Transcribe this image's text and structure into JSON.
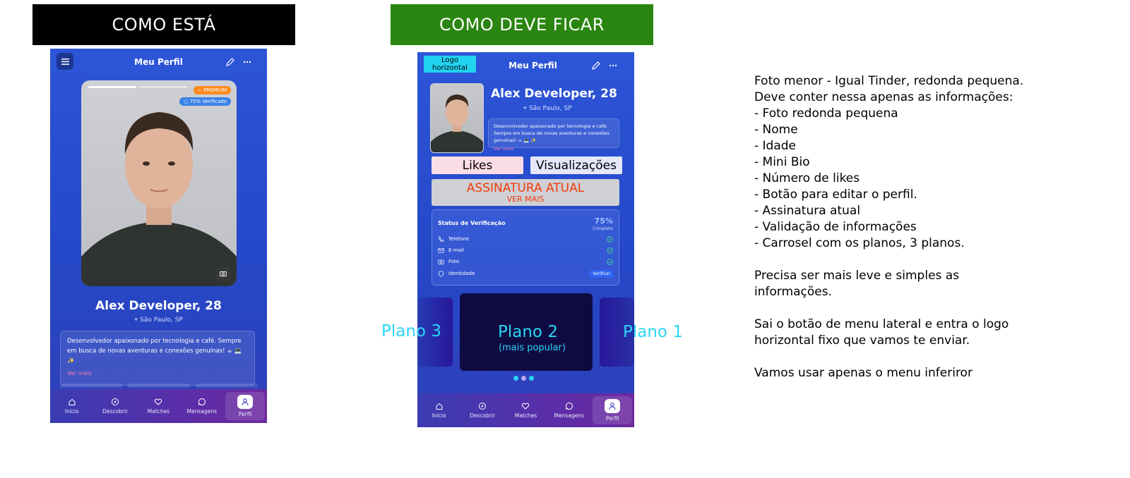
{
  "banners": {
    "current": "COMO ESTÁ",
    "target": "COMO DEVE FICAR"
  },
  "profile": {
    "header_title": "Meu Perfil",
    "name_age": "Alex Developer, 28",
    "location": "São Paulo, SP",
    "bio": "Desenvolvedor apaixonado por tecnologia e café. Sempre em busca de novas aventuras e conexões genuínas! ☕ 💻 ✨",
    "see_more": "Ver mais",
    "badge_premium": "☆ PREMIUM",
    "badge_verified": "○ 75% Verificado"
  },
  "target_mockup": {
    "logo_placeholder": "Logo horizontal",
    "likes_label": "Likes",
    "views_label": "Visualizações",
    "subscription_title": "ASSINATURA ATUAL",
    "subscription_more": "VER MAIS",
    "verification": {
      "title": "Status de Verificação",
      "percent": "75%",
      "percent_caption": "Completo",
      "items": [
        {
          "label": "Telefone",
          "status": "verified",
          "icon": "phone-icon"
        },
        {
          "label": "E-mail",
          "status": "verified",
          "icon": "mail-icon"
        },
        {
          "label": "Foto",
          "status": "verified",
          "icon": "camera-icon"
        },
        {
          "label": "Identidade",
          "status": "pending",
          "icon": "shield-icon",
          "action": "Verificar"
        }
      ]
    },
    "plans": {
      "left": "Plano 3",
      "center": "Plano 2",
      "center_sub": "(mais popular)",
      "right": "Plano 1",
      "dot_count": 3
    }
  },
  "nav": [
    {
      "label": "Início",
      "icon": "home-icon",
      "active": false
    },
    {
      "label": "Descobrir",
      "icon": "compass-icon",
      "active": false
    },
    {
      "label": "Matches",
      "icon": "heart-icon",
      "active": false
    },
    {
      "label": "Mensagens",
      "icon": "chat-icon",
      "active": false
    },
    {
      "label": "Perfil",
      "icon": "user-icon",
      "active": true
    }
  ],
  "notes": [
    "Foto menor - Igual Tinder, redonda pequena.",
    "Deve conter nessa apenas as informações:",
    "- Foto redonda pequena",
    "- Nome",
    "- Idade",
    "- Mini Bio",
    "- Número de likes",
    "- Botão para editar o perfil.",
    "- Assinatura atual",
    "- Validação de informações",
    "- Carrosel com os planos, 3 planos.",
    "",
    "Precisa ser mais leve e simples as",
    "informações.",
    "",
    "Sai o botão de menu lateral e entra o logo",
    "horizontal fixo que vamos te enviar.",
    "",
    "Vamos usar apenas o menu inferiror"
  ],
  "colors": {
    "current_banner": "#000000",
    "target_banner": "#2a8610",
    "accent_cyan": "#2bd6f5",
    "subscription_text": "#f23a0a"
  }
}
